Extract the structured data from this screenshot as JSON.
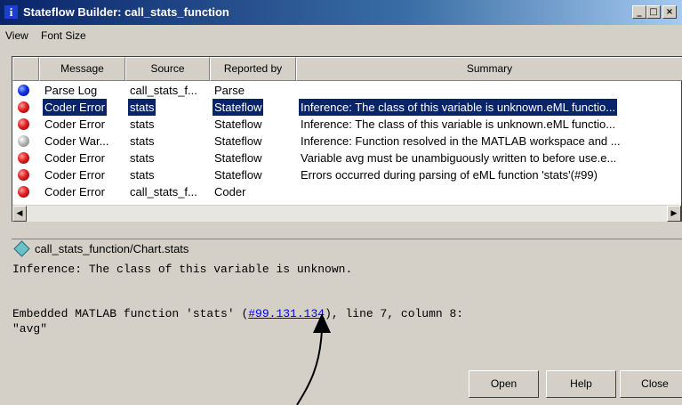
{
  "window": {
    "title": "Stateflow Builder: call_stats_function",
    "title_icon": "i",
    "controls": [
      "_",
      "□",
      "×"
    ]
  },
  "menu": [
    "View",
    "Font Size"
  ],
  "table": {
    "columns": [
      "Message",
      "Source",
      "Reported by",
      "Summary"
    ],
    "rows": [
      {
        "status": "blue",
        "message": "Parse Log",
        "source": "call_stats_f...",
        "reported_by": "Parse",
        "summary": "",
        "selected": false
      },
      {
        "status": "red",
        "message": "Coder Error",
        "source": "stats",
        "reported_by": "Stateflow",
        "summary": "Inference: The class of this variable is unknown.eML functio...",
        "selected": true
      },
      {
        "status": "red",
        "message": "Coder Error",
        "source": "stats",
        "reported_by": "Stateflow",
        "summary": "Inference: The class of this variable is unknown.eML functio...",
        "selected": false
      },
      {
        "status": "gray",
        "message": "Coder War...",
        "source": "stats",
        "reported_by": "Stateflow",
        "summary": "Inference: Function resolved in the MATLAB workspace and ...",
        "selected": false
      },
      {
        "status": "red",
        "message": "Coder Error",
        "source": "stats",
        "reported_by": "Stateflow",
        "summary": "Variable avg must be unambiguously written to before use.e...",
        "selected": false
      },
      {
        "status": "red",
        "message": "Coder Error",
        "source": "stats",
        "reported_by": "Stateflow",
        "summary": "Errors occurred during parsing of eML function 'stats'(#99)",
        "selected": false
      },
      {
        "status": "red",
        "message": "Coder Error",
        "source": "call_stats_f...",
        "reported_by": "Coder",
        "summary": "",
        "selected": false
      }
    ]
  },
  "path": {
    "text": "call_stats_function/Chart.stats",
    "icon": "chart-diamond-icon"
  },
  "detail": {
    "line1": "Inference: The class of this variable is unknown.",
    "line2_prefix": "Embedded MATLAB function 'stats' (",
    "line2_link": "#99.131.134",
    "line2_suffix": "), line 7, column 8:",
    "line3": "\"avg\""
  },
  "buttons": {
    "open": "Open",
    "help": "Help",
    "close": "Close"
  },
  "colors": {
    "selection": "#0a246a",
    "link": "#0000ee",
    "error": "#e02020",
    "info": "#1030e0",
    "warning": "#b8b8b8"
  }
}
